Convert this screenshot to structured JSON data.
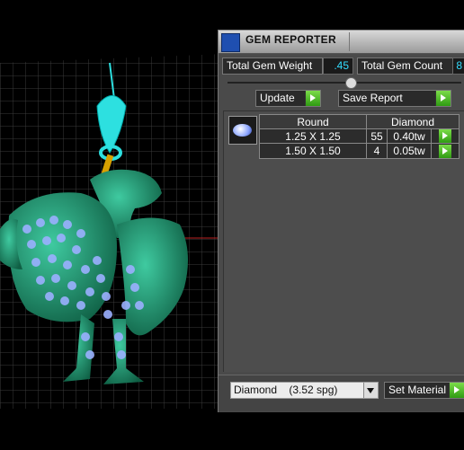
{
  "panel": {
    "title": "GEM REPORTER",
    "total_gem_weight_label": "Total Gem Weight",
    "total_gem_weight_value": ".45",
    "total_gem_count_label": "Total Gem Count",
    "total_gem_count_value": "8",
    "update_button": "Update",
    "save_report_button": "Save Report",
    "table": {
      "headers": [
        "Round",
        "Diamond"
      ],
      "rows": [
        {
          "size": "1.25 X 1.25",
          "count": "55",
          "weight": "0.40tw"
        },
        {
          "size": "1.50 X 1.50",
          "count": "4",
          "weight": "0.05tw"
        }
      ]
    },
    "material_select": "Diamond    (3.52 spg)",
    "set_material_button": "Set Material"
  },
  "colors": {
    "accent_value": "#33ddff",
    "arrow_green": "#3fae1c",
    "panel_bg": "#4a4a4a",
    "model_green": "#1f8f6a",
    "gem_blue": "#8aa4ff",
    "bail_cyan": "#2de0e0"
  }
}
